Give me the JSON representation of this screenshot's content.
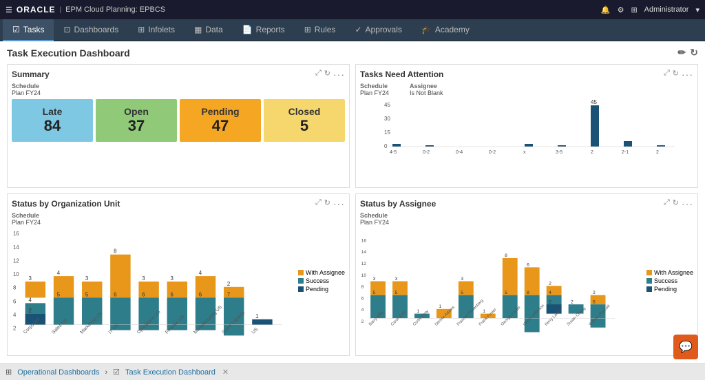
{
  "topbar": {
    "oracle_label": "ORACLE",
    "app_label": "EPM Cloud Planning: EPBCS",
    "admin_label": "Administrator"
  },
  "nav": {
    "tabs": [
      {
        "id": "tasks",
        "label": "Tasks",
        "active": true
      },
      {
        "id": "dashboards",
        "label": "Dashboards",
        "active": false
      },
      {
        "id": "infolets",
        "label": "Infolets",
        "active": false
      },
      {
        "id": "data",
        "label": "Data",
        "active": false
      },
      {
        "id": "reports",
        "label": "Reports",
        "active": false
      },
      {
        "id": "rules",
        "label": "Rules",
        "active": false
      },
      {
        "id": "approvals",
        "label": "Approvals",
        "active": false
      },
      {
        "id": "academy",
        "label": "Academy",
        "active": false
      }
    ]
  },
  "dashboard": {
    "title": "Task Execution Dashboard",
    "panels": {
      "summary": {
        "title": "Summary",
        "schedule_label": "Schedule",
        "schedule_value": "Plan FY24",
        "statuses": [
          {
            "id": "late",
            "label": "Late",
            "value": "84"
          },
          {
            "id": "open",
            "label": "Open",
            "value": "37"
          },
          {
            "id": "pending",
            "label": "Pending",
            "value": "47"
          },
          {
            "id": "closed",
            "label": "Closed",
            "value": "5"
          }
        ]
      },
      "tasks_attention": {
        "title": "Tasks Need Attention",
        "schedule_label": "Schedule",
        "schedule_value": "Plan FY24",
        "assignee_label": "Assignee",
        "assignee_value": "Is Not Blank",
        "bars": [
          {
            "label": "4-5",
            "value": 2
          },
          {
            "label": "0-2",
            "value": 1
          },
          {
            "label": "0-4",
            "value": 0
          },
          {
            "label": "0-2",
            "value": 0
          },
          {
            "label": "x",
            "value": 2
          },
          {
            "label": "3-5",
            "value": 1
          },
          {
            "label": "2",
            "value": 45
          },
          {
            "label": "2-1",
            "value": 3
          },
          {
            "label": "2",
            "value": 1
          }
        ]
      },
      "status_org": {
        "title": "Status by Organization Unit",
        "schedule_label": "Schedule",
        "schedule_value": "Plan FY24",
        "legend": [
          {
            "label": "With Assignee",
            "color": "#e8971a"
          },
          {
            "label": "Success",
            "color": "#2e7d8a"
          },
          {
            "label": "Pending",
            "color": "#1a5276"
          }
        ],
        "categories": [
          "Corporate",
          "Sales US",
          "Marketing US",
          "IT US",
          "Operations US",
          "Finance US",
          "Manufacturing US",
          "Sales Canada",
          "US"
        ],
        "series": {
          "with_assignee": [
            3,
            4,
            3,
            8,
            3,
            3,
            4,
            2,
            0
          ],
          "success": [
            4,
            5,
            5,
            6,
            6,
            6,
            6,
            7,
            0
          ],
          "pending": [
            2,
            0,
            0,
            0,
            0,
            0,
            0,
            0,
            1
          ]
        }
      },
      "status_assignee": {
        "title": "Status by Assignee",
        "schedule_label": "Schedule",
        "schedule_value": "Plan FY24",
        "legend": [
          {
            "label": "With Assignee",
            "color": "#e8971a"
          },
          {
            "label": "Success",
            "color": "#2e7d8a"
          },
          {
            "label": "Pending",
            "color": "#1a5276"
          }
        ],
        "categories": [
          "Barry Mills",
          "Carol Judd",
          "Curtis Finty",
          "Denise Adams",
          "Frances Rosenberg",
          "Frank Foster",
          "George Foster",
          "Henry Jefferson",
          "Kerry Lane",
          "Susan Chang",
          "William Rascott"
        ],
        "series": {
          "with_assignee": [
            3,
            3,
            0,
            1,
            3,
            1,
            8,
            6,
            2,
            0,
            2
          ],
          "success": [
            5,
            5,
            1,
            0,
            5,
            0,
            5,
            8,
            4,
            2,
            5
          ],
          "pending": [
            0,
            0,
            0,
            0,
            0,
            0,
            0,
            0,
            2,
            0,
            0
          ]
        }
      }
    }
  },
  "footer": {
    "operational_label": "Operational Dashboards",
    "active_tab": "Task Execution Dashboard"
  }
}
